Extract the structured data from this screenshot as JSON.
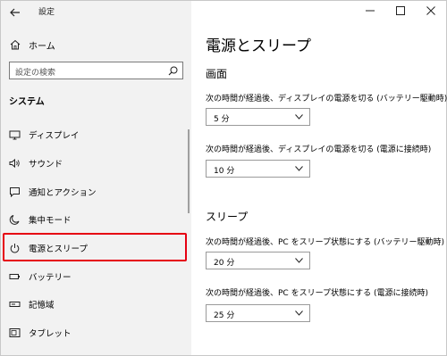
{
  "app": {
    "title": "設定"
  },
  "window_controls": {
    "minimize": "—",
    "maximize": "☐",
    "close": "✕"
  },
  "sidebar": {
    "home_label": "ホーム",
    "search_placeholder": "設定の検索",
    "section_title": "システム",
    "items": [
      {
        "label": "ディスプレイ",
        "icon": "monitor-icon"
      },
      {
        "label": "サウンド",
        "icon": "speaker-icon"
      },
      {
        "label": "通知とアクション",
        "icon": "notification-icon"
      },
      {
        "label": "集中モード",
        "icon": "moon-icon"
      },
      {
        "label": "電源とスリープ",
        "icon": "power-icon",
        "selected": true
      },
      {
        "label": "バッテリー",
        "icon": "battery-icon"
      },
      {
        "label": "記憶域",
        "icon": "storage-icon"
      },
      {
        "label": "タブレット",
        "icon": "tablet-icon"
      }
    ]
  },
  "main": {
    "title": "電源とスリープ",
    "screen_heading": "画面",
    "screen_battery_label": "次の時間が経過後、ディスプレイの電源を切る (バッテリー駆動時)",
    "screen_battery_value": "5 分",
    "screen_plugged_label": "次の時間が経過後、ディスプレイの電源を切る (電源に接続時)",
    "screen_plugged_value": "10 分",
    "sleep_heading": "スリープ",
    "sleep_battery_label": "次の時間が経過後、PC をスリープ状態にする (バッテリー駆動時)",
    "sleep_battery_value": "20 分",
    "sleep_plugged_label": "次の時間が経過後、PC をスリープ状態にする (電源に接続時)",
    "sleep_plugged_value": "25 分"
  },
  "colors": {
    "highlight_border": "#e60012",
    "sidebar_bg": "#f2f2f2"
  }
}
